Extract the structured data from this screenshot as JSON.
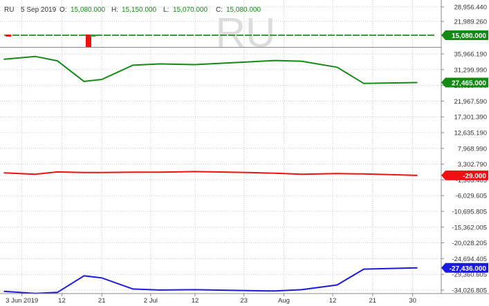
{
  "header": {
    "symbol": "RU",
    "date": "5 Sep 2019",
    "open_label": "O:",
    "open": "15,080.000",
    "high_label": "H:",
    "high": "15,150.000",
    "low_label": "L:",
    "low": "15,070.000",
    "close_label": "C:",
    "close": "15,080.000"
  },
  "watermark": "RU",
  "colors": {
    "price": "#3a9a3a",
    "green_line": "#148a14",
    "red_line": "#ee1111",
    "blue_line": "#1a1ae0",
    "grid": "#c8c8c8",
    "axis_text": "#333333"
  },
  "chart_data": {
    "type": "line",
    "x_ticks": [
      "3 Jun 2019",
      "12",
      "21",
      "2 Jul",
      "12",
      "23",
      "Aug",
      "12",
      "21",
      "30"
    ],
    "y_ticks": [
      "28,956.440",
      "21,989.260",
      "35,966.190",
      "31,299.990",
      "26,633.790",
      "21,967.590",
      "17,301.390",
      "12,635.190",
      "7,968.990",
      "3,302.790",
      "-1,363.405",
      "-6,029.605",
      "-10,695.805",
      "-15,362.005",
      "-20,028.205",
      "-24,694.405",
      "-29,360.605",
      "-34,026.805"
    ],
    "price_panel": {
      "last_label": "15,080.000",
      "volume_bars": [
        {
          "date": "2019-05-31",
          "color": "red"
        },
        {
          "date": "2019-06-18",
          "color": "red",
          "large": true
        },
        {
          "date": "2019-06-19",
          "color": "green"
        }
      ]
    },
    "series": [
      {
        "color": "green",
        "last_label": "27,465.000",
        "points": [
          [
            "2019-05-30",
            34400
          ],
          [
            "2019-06-06",
            35200
          ],
          [
            "2019-06-11",
            33900
          ],
          [
            "2019-06-17",
            27800
          ],
          [
            "2019-06-21",
            28400
          ],
          [
            "2019-06-28",
            32600
          ],
          [
            "2019-07-04",
            33000
          ],
          [
            "2019-07-12",
            32800
          ],
          [
            "2019-07-24",
            33600
          ],
          [
            "2019-07-30",
            34000
          ],
          [
            "2019-08-05",
            33800
          ],
          [
            "2019-08-13",
            32000
          ],
          [
            "2019-08-19",
            27200
          ],
          [
            "2019-08-31",
            27465
          ]
        ]
      },
      {
        "color": "red",
        "last_label": "-29.000",
        "points": [
          [
            "2019-05-30",
            700
          ],
          [
            "2019-06-06",
            300
          ],
          [
            "2019-06-11",
            1000
          ],
          [
            "2019-06-17",
            800
          ],
          [
            "2019-06-21",
            800
          ],
          [
            "2019-06-28",
            900
          ],
          [
            "2019-07-04",
            900
          ],
          [
            "2019-07-12",
            1100
          ],
          [
            "2019-07-24",
            800
          ],
          [
            "2019-07-30",
            600
          ],
          [
            "2019-08-05",
            300
          ],
          [
            "2019-08-13",
            500
          ],
          [
            "2019-08-19",
            400
          ],
          [
            "2019-08-31",
            -29
          ]
        ]
      },
      {
        "color": "blue",
        "last_label": "-27,436.000",
        "points": [
          [
            "2019-05-30",
            -34400
          ],
          [
            "2019-06-06",
            -35000
          ],
          [
            "2019-06-11",
            -34700
          ],
          [
            "2019-06-17",
            -29800
          ],
          [
            "2019-06-21",
            -30400
          ],
          [
            "2019-06-28",
            -33700
          ],
          [
            "2019-07-04",
            -34000
          ],
          [
            "2019-07-12",
            -33900
          ],
          [
            "2019-07-24",
            -34200
          ],
          [
            "2019-07-30",
            -34300
          ],
          [
            "2019-08-05",
            -33900
          ],
          [
            "2019-08-13",
            -32500
          ],
          [
            "2019-08-19",
            -27800
          ],
          [
            "2019-08-31",
            -27436
          ]
        ]
      }
    ],
    "grid": true
  }
}
